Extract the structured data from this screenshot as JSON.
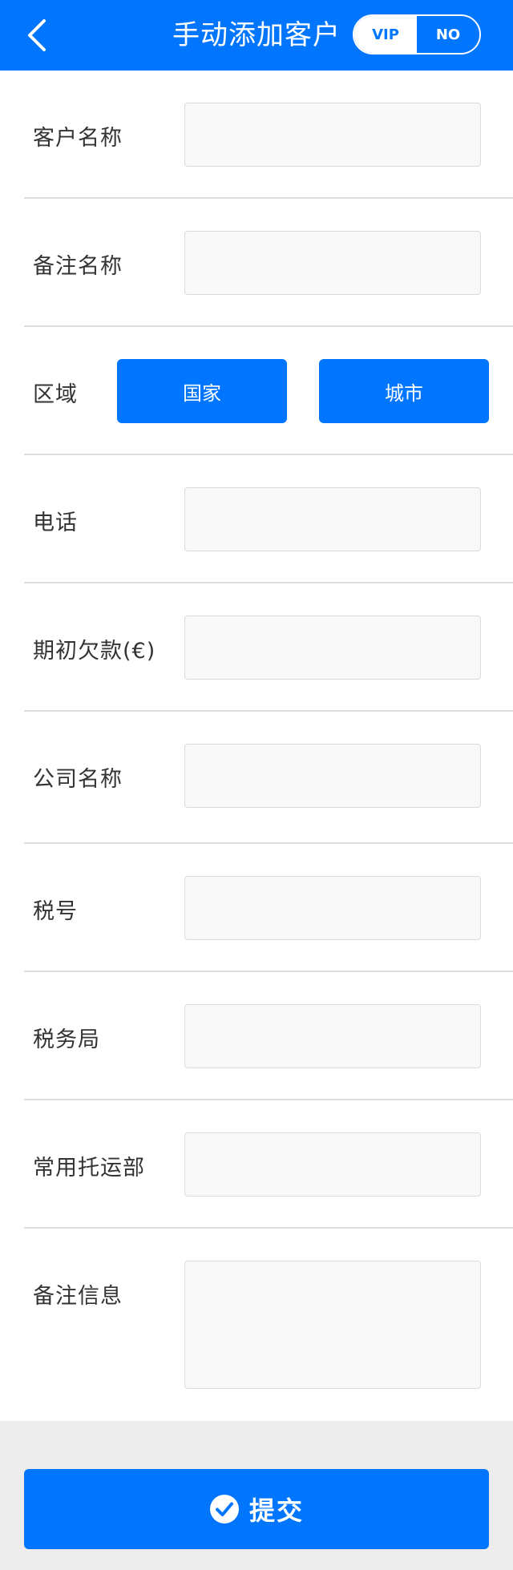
{
  "header": {
    "title": "手动添加客户",
    "toggle": {
      "on_label": "VIP",
      "off_label": "NO",
      "selected": "VIP"
    }
  },
  "form": {
    "customer_name": {
      "label": "客户名称",
      "value": ""
    },
    "remark_name": {
      "label": "备注名称",
      "value": ""
    },
    "region": {
      "label": "区域",
      "country_label": "国家",
      "city_label": "城市"
    },
    "phone": {
      "label": "电话",
      "value": ""
    },
    "opening_debt": {
      "label": "期初欠款(€)",
      "value": ""
    },
    "company_name": {
      "label": "公司名称",
      "value": ""
    },
    "tax_number": {
      "label": "税号",
      "value": ""
    },
    "tax_office": {
      "label": "税务局",
      "value": ""
    },
    "freight_dept": {
      "label": "常用托运部",
      "value": ""
    },
    "remark_info": {
      "label": "备注信息",
      "value": ""
    }
  },
  "footer": {
    "submit_label": "提交"
  },
  "colors": {
    "accent": "#0076fe",
    "field_bg": "#f8f8f8",
    "footer_bg": "#ececec"
  },
  "icons": {
    "back": "chevron-left-icon",
    "submit": "check-circle-icon"
  }
}
